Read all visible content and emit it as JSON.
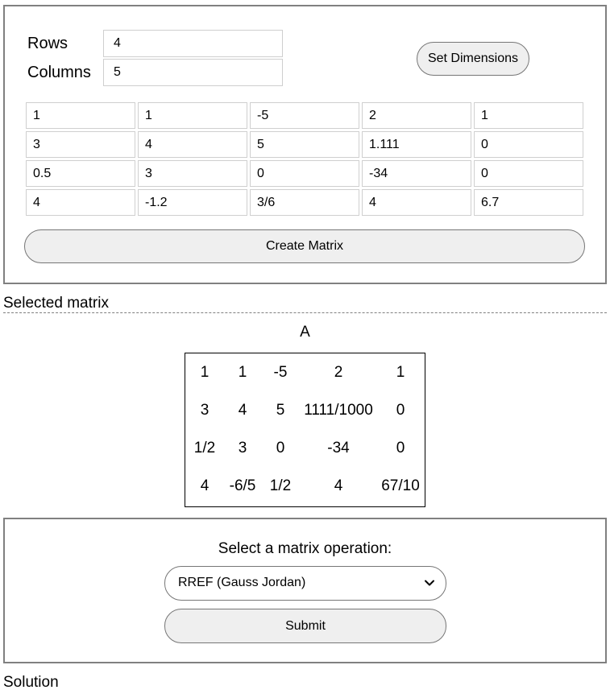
{
  "dimensions": {
    "rows_label": "Rows",
    "rows_value": "4",
    "columns_label": "Columns",
    "columns_value": "5",
    "set_button": "Set Dimensions"
  },
  "input_grid": [
    [
      "1",
      "1",
      "-5",
      "2",
      "1"
    ],
    [
      "3",
      "4",
      "5",
      "1.111",
      "0"
    ],
    [
      "0.5",
      "3",
      "0",
      "-34",
      "0"
    ],
    [
      "4",
      "-1.2",
      "3/6",
      "4",
      "6.7"
    ]
  ],
  "create_button": "Create Matrix",
  "selected": {
    "heading": "Selected matrix",
    "name": "A",
    "values": [
      [
        "1",
        "1",
        "-5",
        "2",
        "1"
      ],
      [
        "3",
        "4",
        "5",
        "1111/1000",
        "0"
      ],
      [
        "1/2",
        "3",
        "0",
        "-34",
        "0"
      ],
      [
        "4",
        "-6/5",
        "1/2",
        "4",
        "67/10"
      ]
    ]
  },
  "operation": {
    "heading": "Select a matrix operation:",
    "selected_option": "RREF (Gauss Jordan)",
    "submit_label": "Submit"
  },
  "solution_heading": "Solution"
}
